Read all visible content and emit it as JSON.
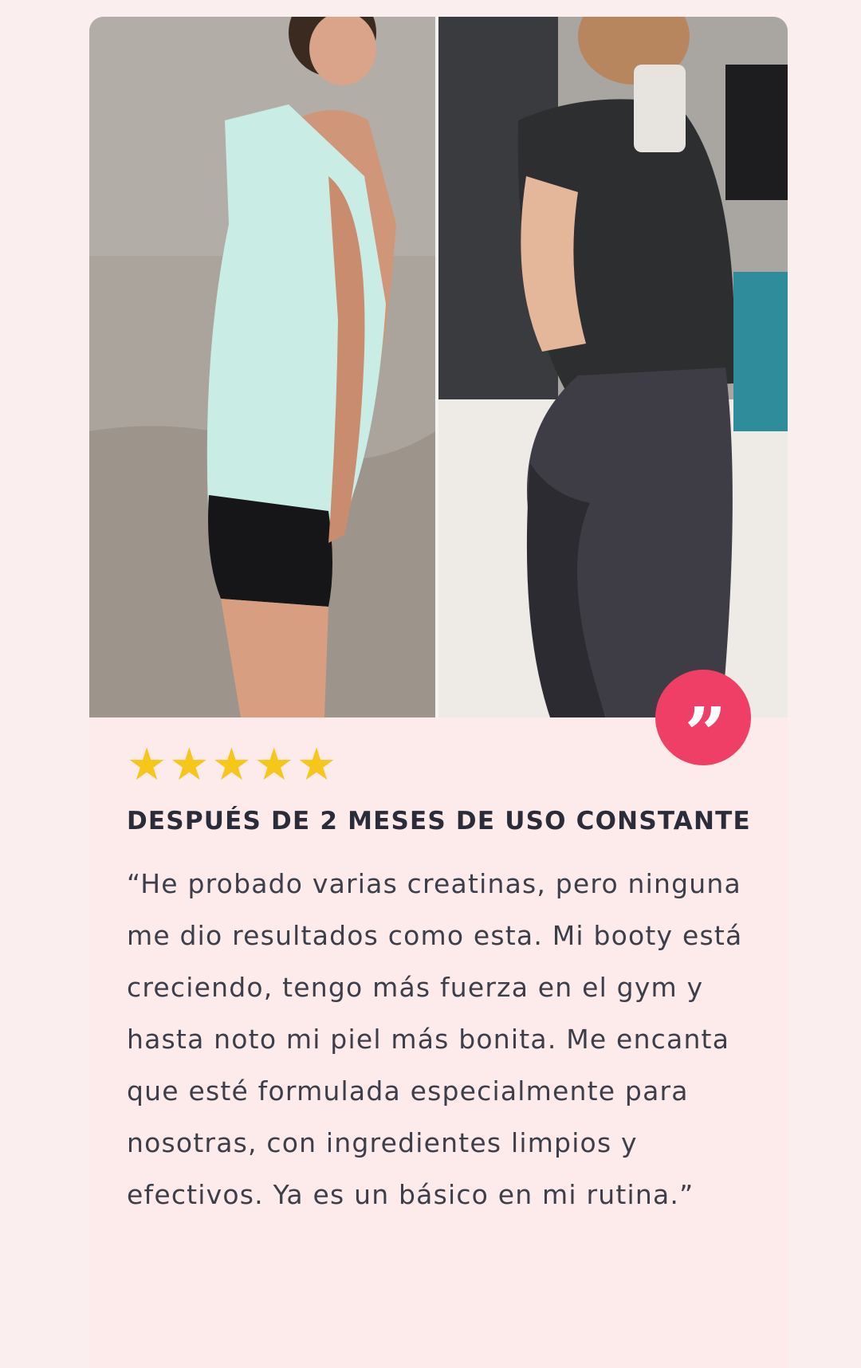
{
  "review": {
    "rating": 5,
    "stars": [
      "★",
      "★",
      "★",
      "★",
      "★"
    ],
    "title": "DESPUÉS DE 2 MESES DE USO CONSTANTE",
    "body": "“He probado varias creatinas, pero ninguna me dio resultados como esta. Mi booty está creciendo, tengo más fuerza en el gym y hasta noto mi piel más bonita. Me encanta que esté formulada especialmente para nosotras, con ingredientes limpios y efectivos. Ya es un básico en mi rutina.”",
    "quote_icon": "quote-icon",
    "quote_glyph": "”",
    "colors": {
      "badge": "#ef3f67",
      "star": "#f6c71a",
      "card_background": "#fdeaea",
      "title": "#2a2c3a",
      "body": "#3c3e4a"
    }
  },
  "media": {
    "before_icon": "before-photo",
    "after_icon": "after-photo"
  }
}
